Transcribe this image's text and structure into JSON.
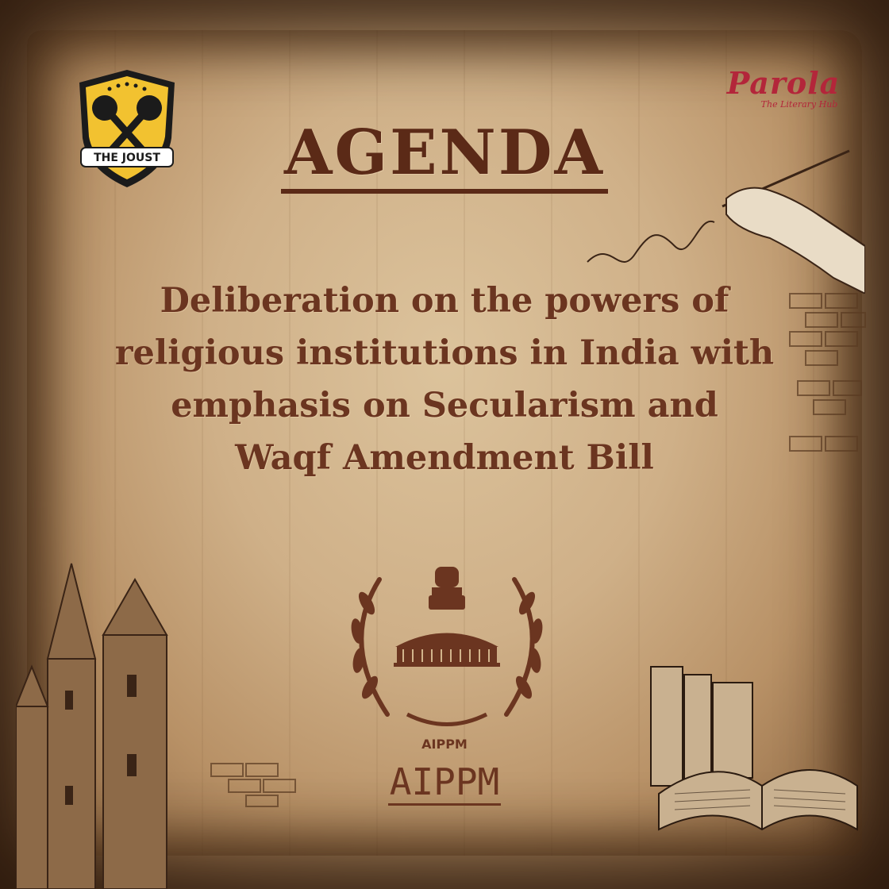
{
  "logos": {
    "left": {
      "text": "THE JOUST",
      "icon": "the-joust-shield-logo"
    },
    "right": {
      "name": "Parola",
      "subtitle": "The Literary Hub",
      "icon": "parola-book-logo"
    }
  },
  "heading": "AGENDA",
  "agenda_lines": [
    "Deliberation on the powers of",
    "religious institutions in India with",
    "emphasis on Secularism and",
    "Waqf Amendment Bill"
  ],
  "emblem": {
    "label": "AIPPM",
    "icon": "aippm-parliament-emblem"
  },
  "committee": "AIPPM",
  "colors": {
    "text_primary": "#5b2a17",
    "text_body": "#6b3520",
    "parchment": "#cfb088",
    "accent_red": "#b3263a",
    "shield_yellow": "#f2c230"
  }
}
